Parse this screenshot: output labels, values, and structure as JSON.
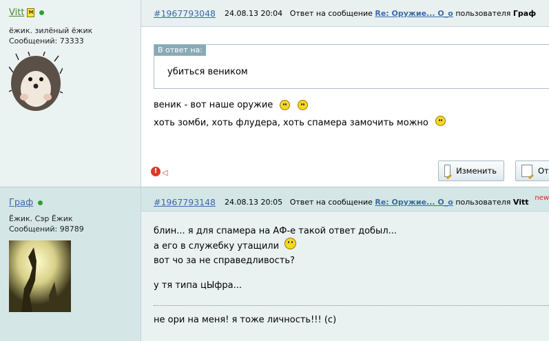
{
  "post1": {
    "author": "Vitt",
    "user_title": "ёжик. зилёный ёжик",
    "message_count": "Сообщений: 73333",
    "post_id": "#1967793048",
    "datetime": "24.08.13 20:04",
    "reply_prefix": "Ответ на сообщение",
    "reply_link": "Re: Оружие... О_о",
    "by_user_prefix": "пользователя",
    "reply_to_user": "Граф",
    "quote_label": "В ответ на:",
    "quote_text": "убиться веником",
    "line1": "веник - вот наше оружие",
    "line2": "хоть зомби, хоть флудера, хоть спамера замочить можно",
    "edit_label": "Изменить",
    "quote_btn_label": "От"
  },
  "post2": {
    "author": "Граф",
    "user_title": "Ёжик. Сэр Ёжик",
    "message_count": "Сообщений: 98789",
    "post_id": "#1967793148",
    "datetime": "24.08.13 20:05",
    "reply_prefix": "Ответ на сообщение",
    "reply_link": "Re: Оружие... О_о",
    "by_user_prefix": "пользователя",
    "reply_to_user": "Vitt",
    "new_badge": "new",
    "line1": "блин... я для спамера на АФ-е такой ответ добыл...",
    "line2": "а его в служебку утащили",
    "line3": "вот чо за не справедливость?",
    "line4": "у тя типа цЫфра...",
    "signature": "не ори на меня! я тоже личность!!! (с)"
  },
  "icons": {
    "online": "online-status-icon",
    "moderator": "moderator-badge-icon",
    "warn": "report-warning-icon",
    "edit": "edit-document-icon"
  }
}
